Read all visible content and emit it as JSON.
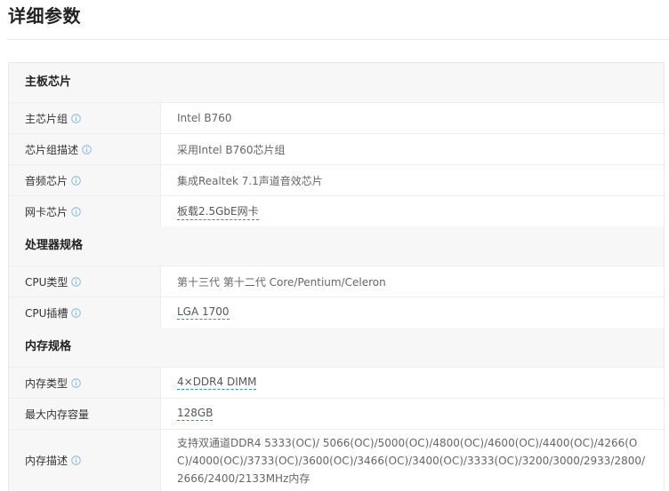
{
  "page": {
    "title": "详细参数"
  },
  "sections": [
    {
      "heading": "主板芯片",
      "rows": [
        {
          "label": "主芯片组",
          "value": "Intel B760",
          "info": true,
          "link": false
        },
        {
          "label": "芯片组描述",
          "value": "采用Intel B760芯片组",
          "info": true,
          "link": false
        },
        {
          "label": "音频芯片",
          "value": "集成Realtek 7.1声道音效芯片",
          "info": true,
          "link": false
        },
        {
          "label": "网卡芯片",
          "value": "板载2.5GbE网卡",
          "info": true,
          "link": true
        }
      ]
    },
    {
      "heading": "处理器规格",
      "rows": [
        {
          "label": "CPU类型",
          "value": "第十三代 第十二代 Core/Pentium/Celeron",
          "info": true,
          "link": false
        },
        {
          "label": "CPU插槽",
          "value": "LGA 1700",
          "info": true,
          "link": true
        }
      ]
    },
    {
      "heading": "内存规格",
      "rows": [
        {
          "label": "内存类型",
          "value": "4×DDR4 DIMM",
          "info": true,
          "link": true
        },
        {
          "label": "最大内存容量",
          "value": "128GB",
          "info": false,
          "link": true
        },
        {
          "label": "内存描述",
          "value": "支持双通道DDR4 5333(OC)/ 5066(OC)/5000(OC)/4800(OC)/4600(OC)/4400(OC)/4266(OC)/4000(OC)/3733(OC)/3600(OC)/3466(OC)/3400(OC)/3333(OC)/3200/3000/2933/2800/2666/2400/2133MHz内存",
          "info": true,
          "link": false
        }
      ]
    }
  ],
  "colors": {
    "info_icon": "#7fb6e6",
    "link_underline": "#1e8ee6",
    "section_bg": "#f7f7f7"
  }
}
